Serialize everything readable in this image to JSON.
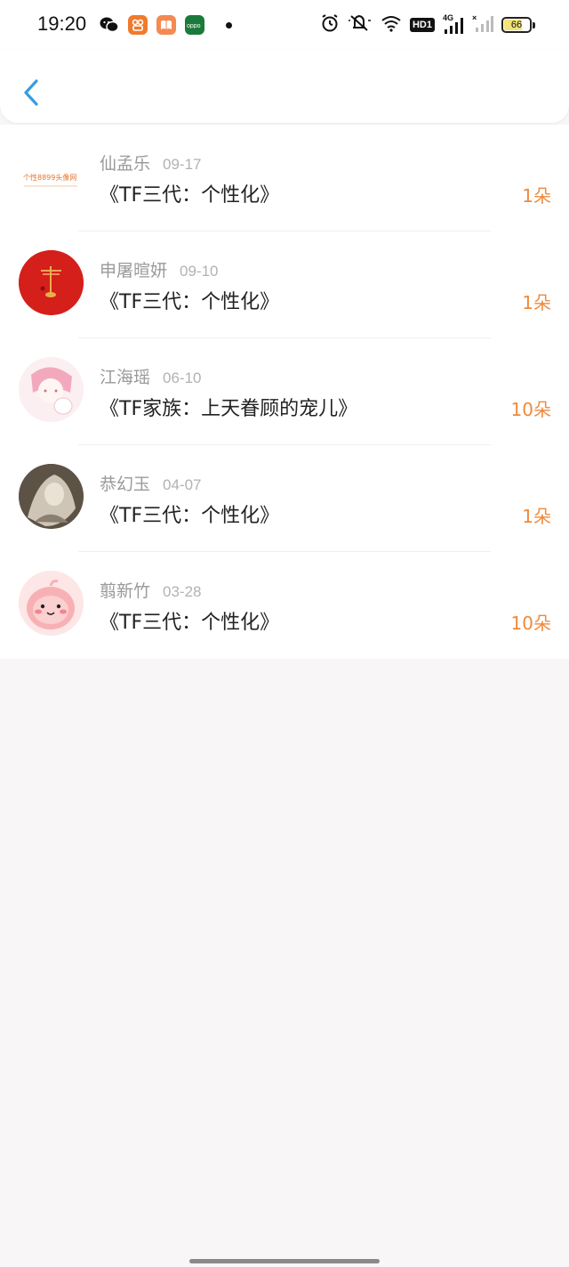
{
  "status_bar": {
    "time": "19:20",
    "app_icons": [
      "wechat-icon",
      "kuaishou-icon",
      "reader-icon",
      "oppo-icon"
    ],
    "signal": "4G",
    "hd_label": "HD1",
    "battery_level": "66"
  },
  "header": {
    "back_icon": "chevron-left-icon",
    "accent": "#3a9be0"
  },
  "records": [
    {
      "name": "仙孟乐",
      "date": "09-17",
      "title": "《TF三代：个性化》",
      "amount": "1朵",
      "avatar_text": "个性8899头像网"
    },
    {
      "name": "申屠暄妍",
      "date": "09-10",
      "title": "《TF三代：个性化》",
      "amount": "1朵"
    },
    {
      "name": "江海瑶",
      "date": "06-10",
      "title": "《TF家族：上天眷顾的宠儿》",
      "amount": "10朵"
    },
    {
      "name": "恭幻玉",
      "date": "04-07",
      "title": "《TF三代：个性化》",
      "amount": "1朵"
    },
    {
      "name": "翦新竹",
      "date": "03-28",
      "title": "《TF三代：个性化》",
      "amount": "10朵"
    }
  ],
  "colors": {
    "amount": "#ef8a3c",
    "name": "#9a9a9a",
    "background": "#f8f6f6"
  }
}
